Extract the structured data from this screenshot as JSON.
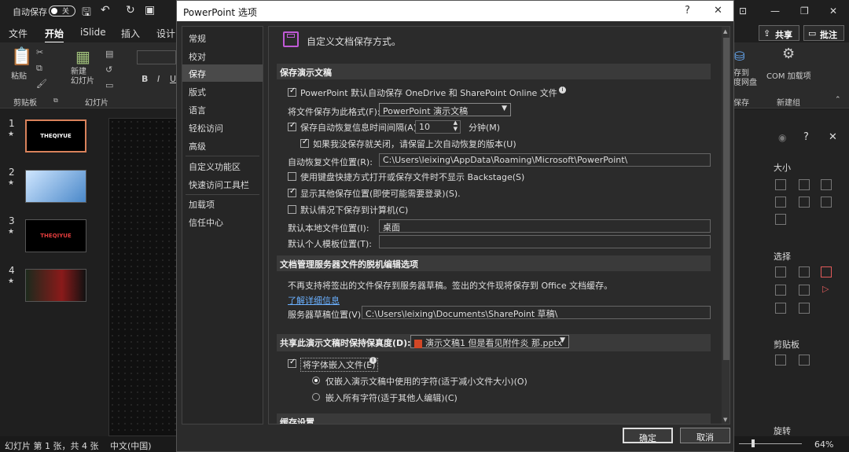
{
  "titlebar": {
    "autosave_label": "自动保存",
    "autosave_state": "关"
  },
  "ribbon": {
    "tabs": [
      "文件",
      "开始",
      "iSlide",
      "插入",
      "设计"
    ],
    "active_tab": "开始",
    "share_label": "共享",
    "comment_label": "批注",
    "paste_label": "粘贴",
    "new_slide_label": "新建\n幻灯片",
    "group_clipboard": "剪贴板",
    "group_slides": "幻灯片",
    "save_to_label": "存到\n度网盘",
    "save_group": "保存",
    "com_label": "COM 加载项",
    "new_group": "新建组"
  },
  "thumbnails": [
    {
      "num": "1",
      "text": "THEQIYUE",
      "selected": true
    },
    {
      "num": "2",
      "text": "",
      "selected": false
    },
    {
      "num": "3",
      "text": "THEQIYUE",
      "selected": false
    },
    {
      "num": "4",
      "text": "",
      "selected": false
    }
  ],
  "rightpane": {
    "size_label": "大小",
    "select_label": "选择",
    "clipboard_label": "剪贴板",
    "rotate_label": "旋转"
  },
  "statusbar": {
    "slide_info": "幻灯片 第 1 张，共 4 张",
    "language": "中文(中国)",
    "zoom": "64%"
  },
  "dialog": {
    "title": "PowerPoint 选项",
    "help": "?",
    "close": "✕",
    "nav": [
      {
        "label": "常规"
      },
      {
        "label": "校对"
      },
      {
        "label": "保存",
        "selected": true
      },
      {
        "label": "版式"
      },
      {
        "label": "语言"
      },
      {
        "label": "轻松访问"
      },
      {
        "label": "高级"
      },
      {
        "label": "自定义功能区"
      },
      {
        "label": "快速访问工具栏"
      },
      {
        "label": "加载项"
      },
      {
        "label": "信任中心"
      }
    ],
    "header": "自定义文档保存方式。",
    "sec_save": "保存演示文稿",
    "autosave_onedrive": "PowerPoint 默认自动保存 OneDrive 和 SharePoint Online 文件",
    "save_format_label": "将文件保存为此格式(F):",
    "save_format_value": "PowerPoint 演示文稿",
    "autorecover_label": "保存自动恢复信息时间间隔(A)",
    "autorecover_minutes": "10",
    "minutes_label": "分钟(M)",
    "keep_last_label": "如果我没保存就关闭，请保留上次自动恢复的版本(U)",
    "autorecover_loc_label": "自动恢复文件位置(R):",
    "autorecover_loc_value": "C:\\Users\\leixing\\AppData\\Roaming\\Microsoft\\PowerPoint\\",
    "no_backstage_label": "使用键盘快捷方式打开或保存文件时不显示 Backstage(S)",
    "show_other_label": "显示其他保存位置(即使可能需要登录)(S).",
    "default_computer_label": "默认情况下保存到计算机(C)",
    "default_local_label": "默认本地文件位置(I):",
    "default_local_value": "桌面",
    "default_template_label": "默认个人模板位置(T):",
    "default_template_value": "",
    "sec_offline": "文档管理服务器文件的脱机编辑选项",
    "offline_desc": "不再支持将签出的文件保存到服务器草稿。签出的文件现将保存到 Office 文档缓存。",
    "learn_more": "了解详细信息",
    "server_drafts_label": "服务器草稿位置(V):",
    "server_drafts_value": "C:\\Users\\leixing\\Documents\\SharePoint 草稿\\",
    "sec_fidelity": "共享此演示文稿时保持保真度(D):",
    "fidelity_file": "演示文稿1 但是看见附件炎 那.pptx",
    "embed_fonts_label": "将字体嵌入文件(E)",
    "embed_used_label": "仅嵌入演示文稿中使用的字符(适于减小文件大小)(O)",
    "embed_all_label": "嵌入所有字符(适于其他人编辑)(C)",
    "sec_cache": "缓存设置",
    "ok": "确定",
    "cancel": "取消"
  }
}
